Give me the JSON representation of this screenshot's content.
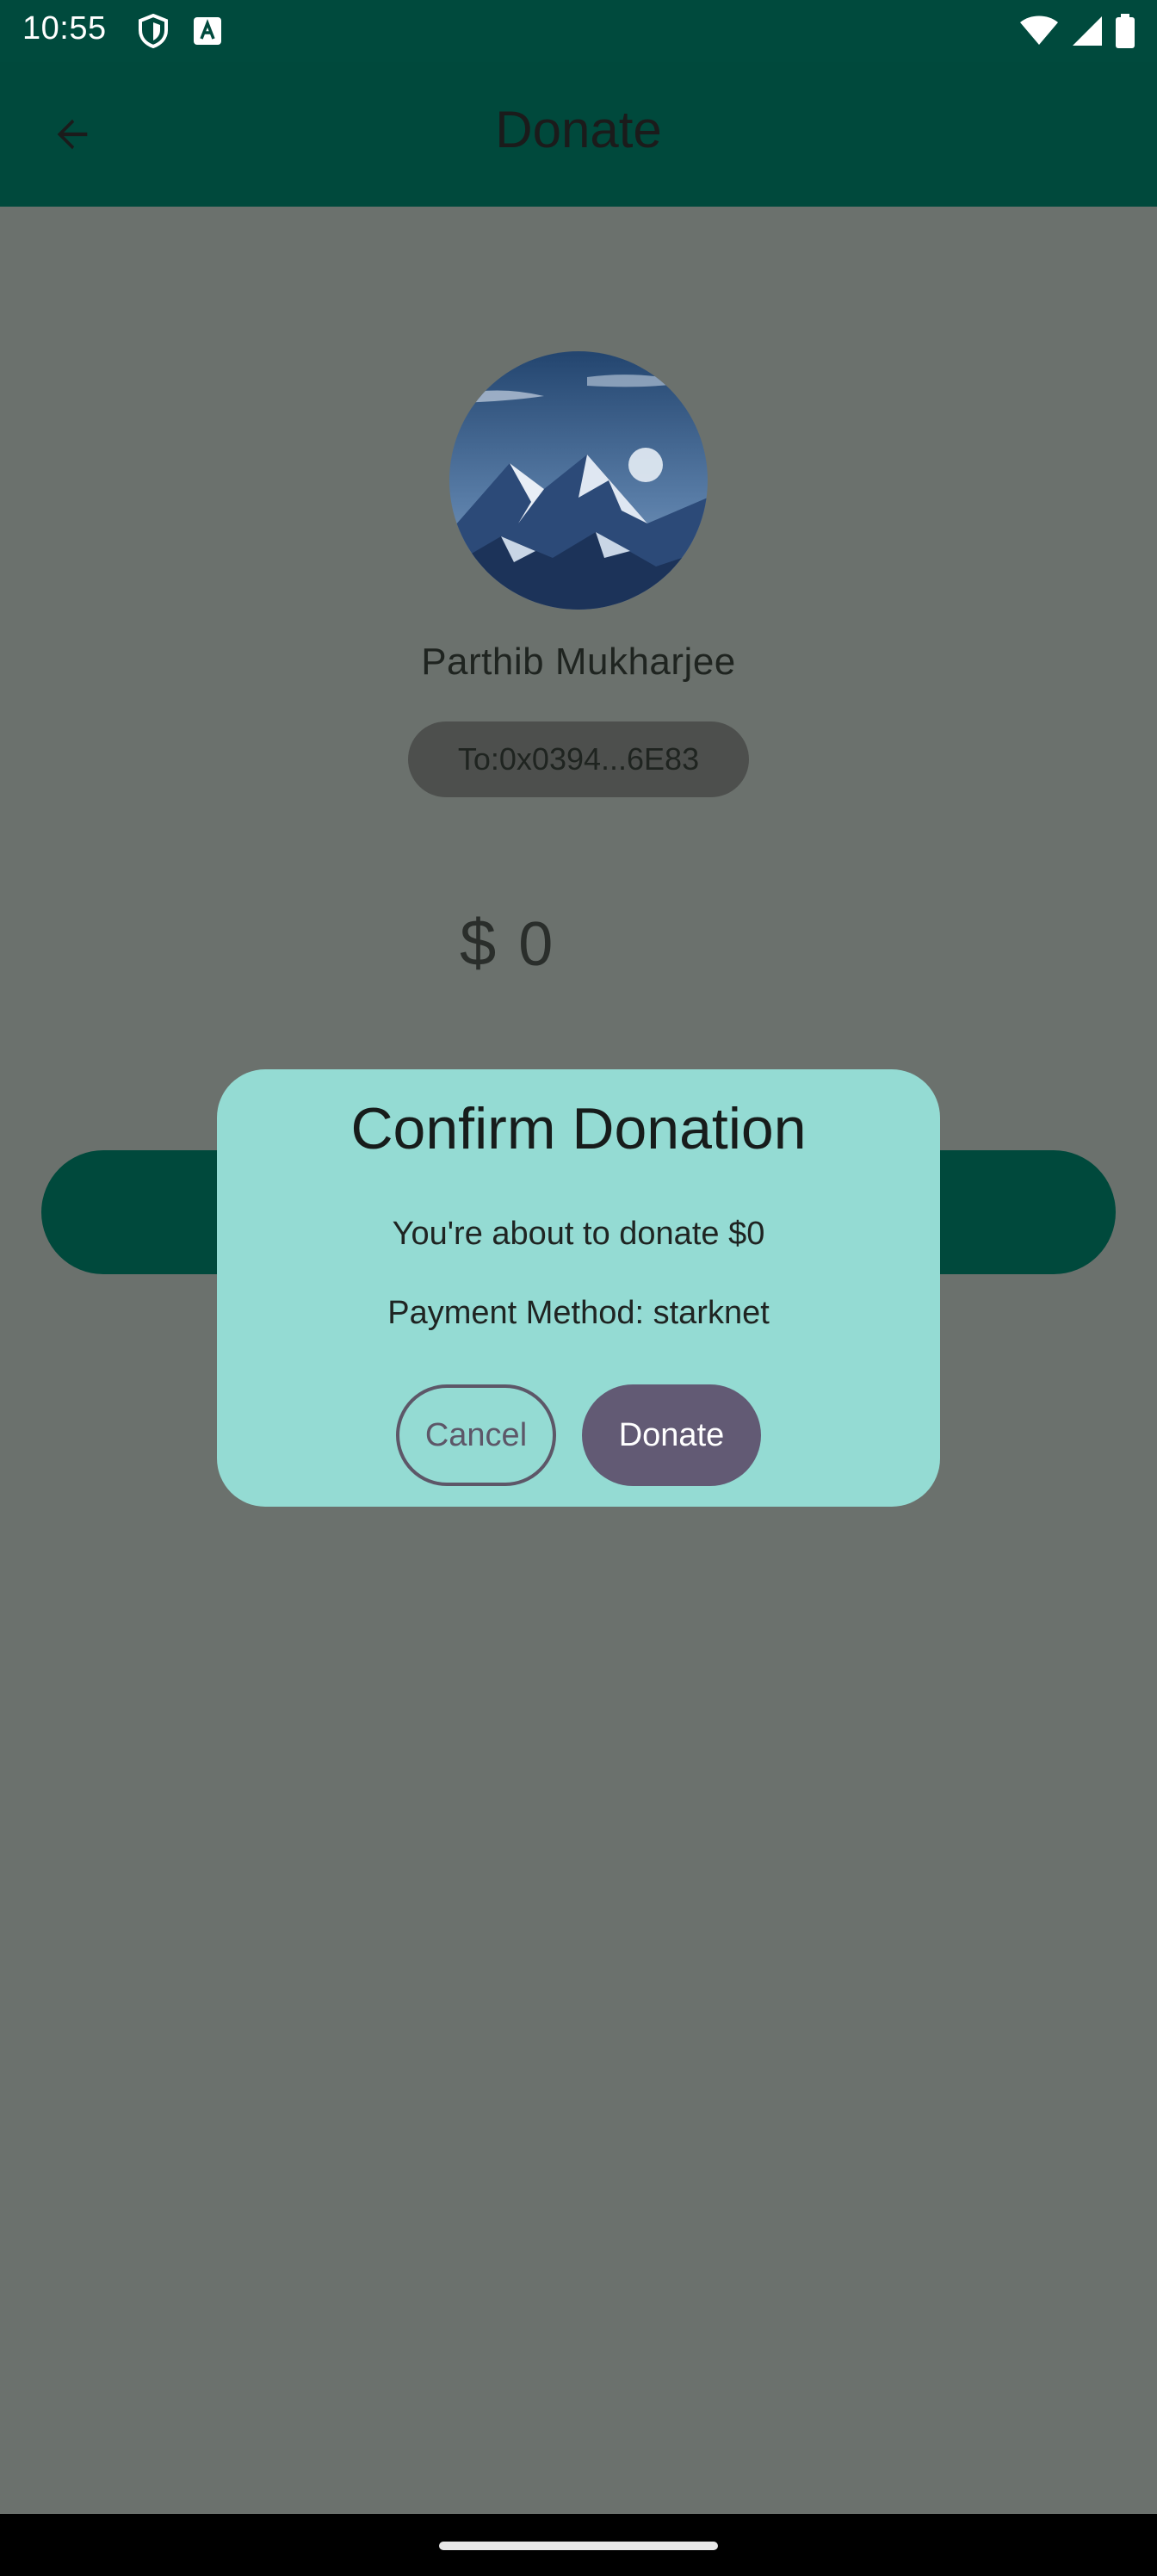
{
  "status_bar": {
    "time": "10:55",
    "left_icons": [
      "shield-icon",
      "keyboard-a-icon"
    ],
    "right_icons": [
      "wifi-icon",
      "signal-icon",
      "battery-icon"
    ]
  },
  "app_bar": {
    "title": "Donate",
    "back_icon": "arrow-back-icon"
  },
  "recipient": {
    "name": "Parthib Mukharjee",
    "address": "To:0x0394...6E83",
    "avatar_icon": "mountain-avatar"
  },
  "amount": {
    "currency": "$",
    "value": "0"
  },
  "dialog": {
    "title": "Confirm Donation",
    "message": "You're about to donate $0",
    "payment_method": "Payment Method: starknet",
    "cancel_label": "Cancel",
    "confirm_label": "Donate"
  },
  "colors": {
    "app_bar": "#00493c",
    "dialog_bg": "#94dbd3",
    "primary_button": "#625a74",
    "scrim": "#6b716d"
  }
}
